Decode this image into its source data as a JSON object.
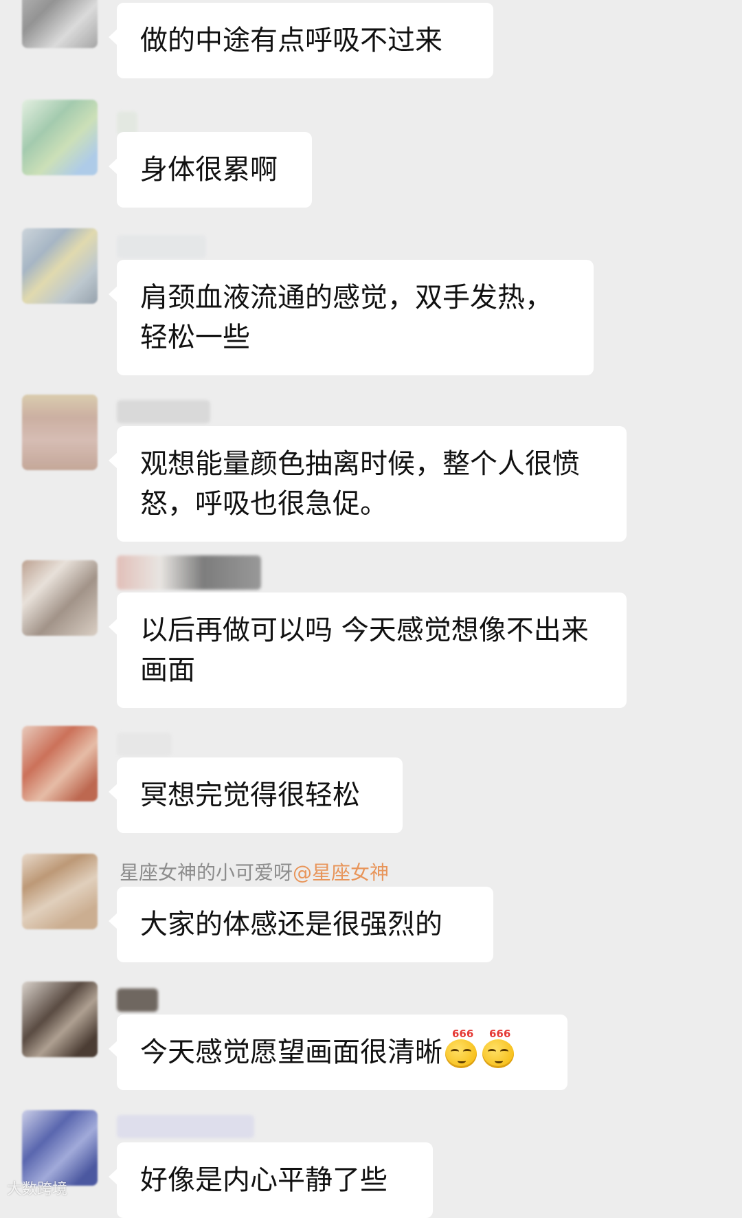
{
  "messages": [
    {
      "text": "做的中途有点呼吸不过来"
    },
    {
      "text": "身体很累啊"
    },
    {
      "text": "肩颈血液流通的感觉，双手发热，轻松一些"
    },
    {
      "text": "观想能量颜色抽离时候，整个人很愤怒，呼吸也很急促。"
    },
    {
      "text": "以后再做可以吗 今天感觉想像不出来画面"
    },
    {
      "text": "冥想完觉得很轻松"
    },
    {
      "sender": "星座女神的小可爱呀",
      "mention": "@星座女神",
      "text": "大家的体感还是很强烈的"
    },
    {
      "text": "今天感觉愿望画面很清晰",
      "emoji_label": "666",
      "emoji_name": "smug-face-666-emoji"
    },
    {
      "text": "好像是内心平静了些"
    }
  ],
  "watermark": "大数跨境",
  "colors": {
    "background": "#ededed",
    "bubble": "#ffffff",
    "nickname": "#8c8c8c",
    "mention": "#e8955a"
  }
}
